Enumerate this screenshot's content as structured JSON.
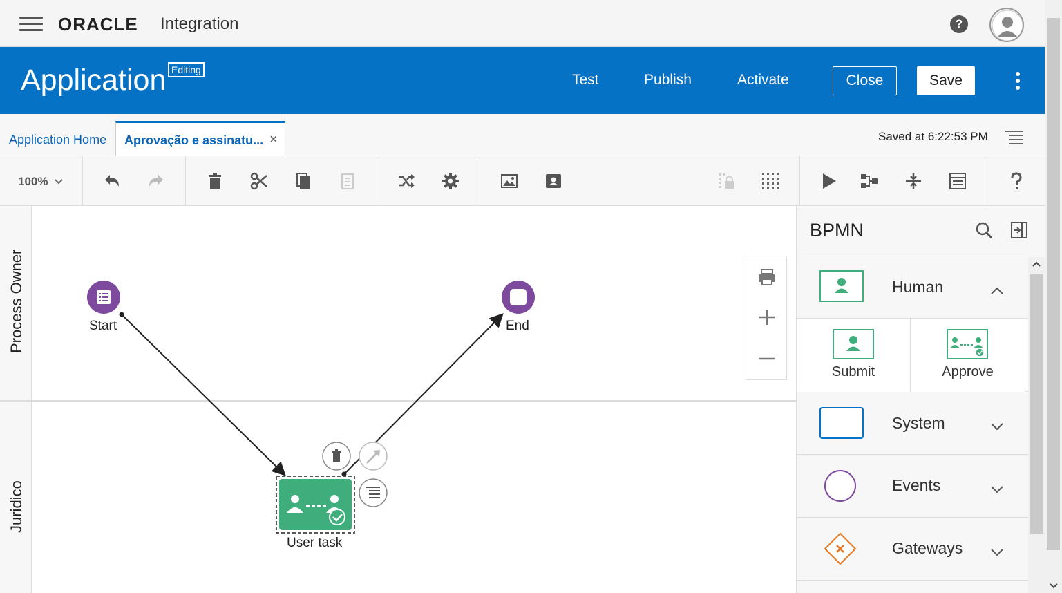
{
  "topbar": {
    "brand": "ORACLE",
    "product": "Integration",
    "help_icon": "?"
  },
  "header": {
    "title": "Application",
    "badge": "Editing",
    "actions": {
      "test": "Test",
      "publish": "Publish",
      "activate": "Activate",
      "close": "Close",
      "save": "Save"
    },
    "background_color": "#0672c6"
  },
  "tabs": {
    "home": "Application Home",
    "active": "Aprovação e assinatu...",
    "close_glyph": "×",
    "saved_status": "Saved at 6:22:53 PM"
  },
  "toolbar": {
    "zoom": "100%"
  },
  "canvas": {
    "lanes": [
      "Process Owner",
      "Juridico"
    ],
    "nodes": {
      "start": "Start",
      "end": "End",
      "user_task": "User task"
    },
    "colors": {
      "event_purple": "#7d4a9e",
      "task_green": "#3fae7c"
    }
  },
  "palette": {
    "title": "BPMN",
    "sections": {
      "human": "Human",
      "system": "System",
      "events": "Events",
      "gateways": "Gateways"
    },
    "human_items": [
      "Submit",
      "Approve"
    ]
  }
}
